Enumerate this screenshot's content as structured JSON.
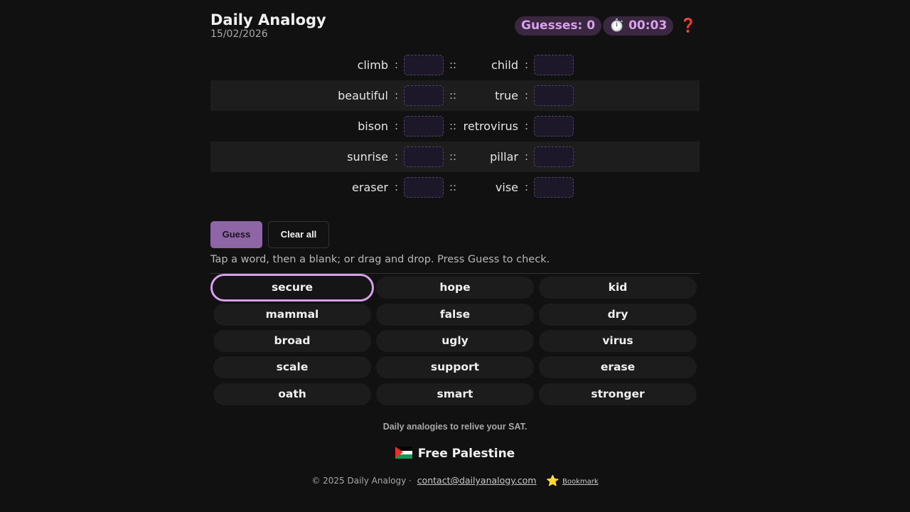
{
  "header": {
    "title": "Daily Analogy",
    "date": "15/02/2026",
    "guesses_label": "Guesses: 0",
    "timer_label": "⏱️ 00:03",
    "help_glyph": "❓"
  },
  "analogies": [
    {
      "a": "climb",
      "c": "child"
    },
    {
      "a": "beautiful",
      "c": "true"
    },
    {
      "a": "bison",
      "c": "retrovirus"
    },
    {
      "a": "sunrise",
      "c": "pillar"
    },
    {
      "a": "eraser",
      "c": "vise"
    }
  ],
  "symbols": {
    "colon": ":",
    "double_colon": "::"
  },
  "actions": {
    "guess_label": "Guess",
    "clear_label": "Clear all"
  },
  "instructions": "Tap a word, then a blank; or drag and drop. Press Guess to check.",
  "word_bank": {
    "selected": "secure",
    "words": [
      "secure",
      "hope",
      "kid",
      "mammal",
      "false",
      "dry",
      "broad",
      "ugly",
      "virus",
      "scale",
      "support",
      "erase",
      "oath",
      "smart",
      "stronger"
    ]
  },
  "footer": {
    "tagline": "Daily analogies to relive your SAT.",
    "palestine": "Free Palestine",
    "copyright": "© 2025 Daily Analogy ·",
    "email": "contact@dailyanalogy.com",
    "bookmark_icon": "⭐",
    "bookmark": "Bookmark"
  },
  "colors": {
    "background": "#111111",
    "accent": "#d9a0f0",
    "guess_button": "#8e66a6",
    "pill_background": "#3a2740"
  }
}
